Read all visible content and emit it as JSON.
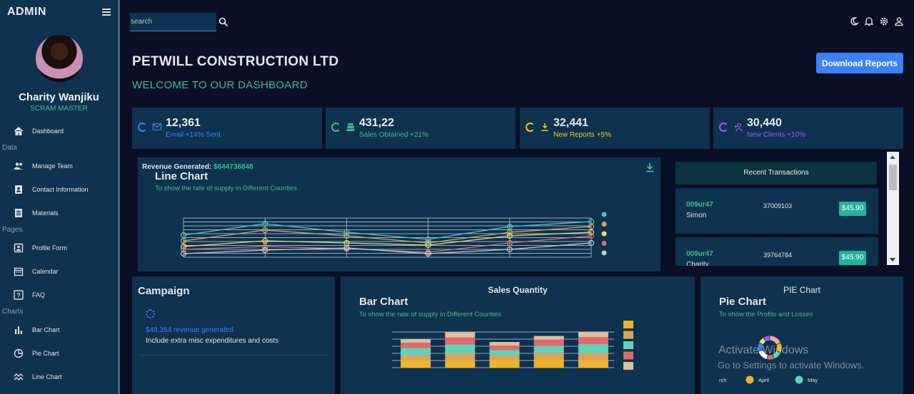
{
  "sidebar": {
    "title": "ADMIN",
    "user": {
      "name": "Charity Wanjiku",
      "role": "SCRAM MASTER"
    },
    "items": [
      {
        "label": "Dashboard",
        "icon": "home-icon"
      },
      {
        "section": "Data"
      },
      {
        "label": "Manage Team",
        "icon": "people-icon"
      },
      {
        "label": "Contact Information",
        "icon": "contacts-icon"
      },
      {
        "label": "Materials",
        "icon": "receipt-icon"
      },
      {
        "section": "Pages"
      },
      {
        "label": "Profile Form",
        "icon": "person-icon"
      },
      {
        "label": "Calendar",
        "icon": "calendar-icon"
      },
      {
        "label": "FAQ",
        "icon": "help-icon"
      },
      {
        "section": "Charts"
      },
      {
        "label": "Bar Chart",
        "icon": "bar-chart-icon"
      },
      {
        "label": "Pie Chart",
        "icon": "pie-chart-icon"
      },
      {
        "label": "Line Chart",
        "icon": "timeline-icon"
      }
    ]
  },
  "topbar": {
    "search_placeholder": "search",
    "icons": [
      "dark-mode-icon",
      "notifications-icon",
      "settings-icon",
      "person-icon"
    ]
  },
  "header": {
    "company": "PETWILL CONSTRUCTION LTD",
    "welcome": "WELCOME TO OUR DASHBOARD",
    "download_label": "Download Reports"
  },
  "stats": [
    {
      "value": "12,361",
      "label": "Email +14% Sent",
      "color": "#3b82f6",
      "icon": "email-icon"
    },
    {
      "value": "431,22",
      "label": "Sales Obtained +21%",
      "color": "#3dbf8f",
      "icon": "point-of-sale-icon"
    },
    {
      "value": "32,441",
      "label": "New Reports +5%",
      "color": "#f5c518",
      "icon": "download-icon"
    },
    {
      "value": "30,440",
      "label": "New Clients +10%",
      "color": "#a855f7",
      "icon": "person-add-icon"
    }
  ],
  "revenue": {
    "label": "Revenue Generated:",
    "value": "$644736848"
  },
  "line_chart": {
    "title": "Line Chart",
    "subtitle": "To show the rate of supply in Different Counties"
  },
  "transactions": {
    "title": "Recent Transactions",
    "items": [
      {
        "txId": "009ur47",
        "user": "Simon",
        "date": "37009103",
        "cost": "$45.90"
      },
      {
        "txId": "009ur47",
        "user": "Charity",
        "date": "39764784",
        "cost": "$45.90"
      }
    ]
  },
  "campaign": {
    "title": "Campaign",
    "revenue": "$48,354 revenue generated",
    "note": "Include extra misc expenditures and costs"
  },
  "bar_panel": {
    "heading": "Sales Quantity",
    "title": "Bar Chart",
    "subtitle": "To show the rate of supply in Different Counties"
  },
  "pie_panel": {
    "heading": "PIE Chart",
    "title": "Pie Chart",
    "subtitle": "To show the Profits and Losses",
    "legend": [
      {
        "label": "rch",
        "color": "#f4a9a0"
      },
      {
        "label": "April",
        "color": "#f0b429"
      },
      {
        "label": "May",
        "color": "#5fd3bc"
      }
    ]
  },
  "watermark": {
    "line1": "Activate Windows",
    "line2": "Go to Settings to activate Windows."
  },
  "chart_data": [
    {
      "type": "line",
      "title": "Line Chart",
      "categories": [
        "",
        "",
        "",
        "",
        "",
        ""
      ],
      "series": [
        {
          "values": [
            56,
            72,
            60,
            50,
            68,
            75
          ],
          "color": "#4fc3c3"
        },
        {
          "values": [
            48,
            63,
            55,
            45,
            60,
            68
          ],
          "color": "#d9a65a"
        },
        {
          "values": [
            40,
            48,
            45,
            42,
            55,
            60
          ],
          "color": "#e8e06a"
        },
        {
          "values": [
            36,
            40,
            37,
            32,
            45,
            55
          ],
          "color": "#e06a6a"
        },
        {
          "values": [
            30,
            35,
            38,
            30,
            36,
            45
          ],
          "color": "#c8c8c8"
        }
      ]
    },
    {
      "type": "bar",
      "title": "Sales Quantity",
      "categories": [
        "",
        "",
        "",
        "",
        ""
      ],
      "series": [
        {
          "values": [
            200,
            180,
            220,
            230,
            200
          ],
          "color": "#f0b429"
        },
        {
          "values": [
            150,
            220,
            120,
            180,
            210
          ],
          "color": "#d9a65a"
        },
        {
          "values": [
            200,
            250,
            150,
            200,
            250
          ],
          "color": "#5fd3bc"
        },
        {
          "values": [
            150,
            200,
            130,
            180,
            200
          ],
          "color": "#e06a6a"
        },
        {
          "values": [
            100,
            150,
            100,
            100,
            150
          ],
          "color": "#d8c0a0"
        }
      ]
    },
    {
      "type": "pie",
      "title": "PIE Chart",
      "values": [
        18,
        14,
        12,
        10,
        16,
        12,
        9,
        9
      ],
      "colors": [
        "#f4a9a0",
        "#f0b429",
        "#5fd3bc",
        "#e06a6a",
        "#ffffff",
        "#3b82f6",
        "#e8e06a",
        "#a855f7"
      ]
    }
  ]
}
